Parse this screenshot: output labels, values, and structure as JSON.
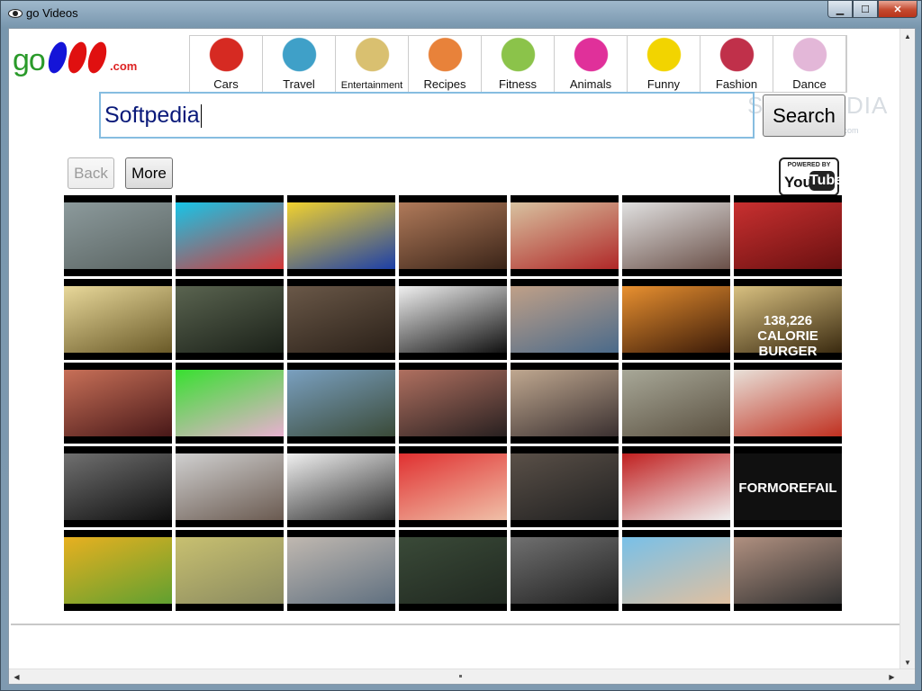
{
  "window": {
    "title": "go Videos"
  },
  "logo": {
    "go": "go",
    "com": ".com"
  },
  "categories": [
    {
      "label": "Cars",
      "icon": "car-icon",
      "color": "#d62a22"
    },
    {
      "label": "Travel",
      "icon": "beach-icon",
      "color": "#3fa0c8"
    },
    {
      "label": "Entertainment",
      "icon": "music-notes-icon",
      "color": "#d9c070"
    },
    {
      "label": "Recipes",
      "icon": "fork-knife-icon",
      "color": "#e8823a"
    },
    {
      "label": "Fitness",
      "icon": "city-icon",
      "color": "#8bc34a"
    },
    {
      "label": "Animals",
      "icon": "animals-icon",
      "color": "#e0309a"
    },
    {
      "label": "Funny",
      "icon": "smiley-icon",
      "color": "#f2d400"
    },
    {
      "label": "Fashion",
      "icon": "models-icon",
      "color": "#c0304a"
    },
    {
      "label": "Dance",
      "icon": "dancer-icon",
      "color": "#e3b7d8"
    }
  ],
  "search": {
    "value": "Softpedia",
    "button_label": "Search"
  },
  "nav": {
    "back_label": "Back",
    "more_label": "More"
  },
  "powered": {
    "line1": "POWERED BY",
    "you": "You",
    "tube": "Tube"
  },
  "watermark": {
    "main": "SOFTPEDIA",
    "sub": "www.softpedia.com"
  },
  "thumbnails": [
    {
      "colors": [
        "#8c9a9c",
        "#5a6462"
      ]
    },
    {
      "colors": [
        "#17c5e8",
        "#d43838"
      ]
    },
    {
      "colors": [
        "#f2d22e",
        "#1c3fa8"
      ]
    },
    {
      "colors": [
        "#b07a5a",
        "#3a2418"
      ]
    },
    {
      "colors": [
        "#d8c2a0",
        "#b02828"
      ]
    },
    {
      "colors": [
        "#e0e0e0",
        "#6a5048"
      ]
    },
    {
      "colors": [
        "#c83030",
        "#6a1010"
      ]
    },
    {
      "colors": [
        "#e8d89a",
        "#6a5a28"
      ]
    },
    {
      "colors": [
        "#5a6450",
        "#1a2018"
      ]
    },
    {
      "colors": [
        "#6a5848",
        "#2a2018"
      ]
    },
    {
      "colors": [
        "#f0f0f0",
        "#101010"
      ]
    },
    {
      "colors": [
        "#c0a088",
        "#4a6a8a"
      ]
    },
    {
      "colors": [
        "#e89030",
        "#3a1a08"
      ]
    },
    {
      "colors": [
        "#d8c080",
        "#3a2a10"
      ],
      "caption": "138,226 CALORIE BURGER"
    },
    {
      "colors": [
        "#c87058",
        "#481818"
      ]
    },
    {
      "colors": [
        "#38e030",
        "#e8b0d0"
      ]
    },
    {
      "colors": [
        "#7aa0c0",
        "#3a4a38"
      ]
    },
    {
      "colors": [
        "#b07060",
        "#282020"
      ]
    },
    {
      "colors": [
        "#c0a890",
        "#3a3030"
      ]
    },
    {
      "colors": [
        "#a8a898",
        "#5a5040"
      ]
    },
    {
      "colors": [
        "#e8e0d8",
        "#c03020"
      ]
    },
    {
      "colors": [
        "#707070",
        "#101010"
      ]
    },
    {
      "colors": [
        "#d0d0d0",
        "#6a5a50"
      ]
    },
    {
      "colors": [
        "#f0f0f0",
        "#2a2a2a"
      ]
    },
    {
      "colors": [
        "#e03030",
        "#f0c0a8"
      ]
    },
    {
      "colors": [
        "#5a5048",
        "#202020"
      ]
    },
    {
      "colors": [
        "#c02020",
        "#f0f0f0"
      ]
    },
    {
      "colors": [
        "#101010",
        "#101010"
      ],
      "caption": "FORMOREFAIL"
    },
    {
      "colors": [
        "#e8b020",
        "#60a030"
      ]
    },
    {
      "colors": [
        "#c8c070",
        "#8a8a60"
      ]
    },
    {
      "colors": [
        "#c0b8b0",
        "#607080"
      ]
    },
    {
      "colors": [
        "#3a4a38",
        "#202820"
      ]
    },
    {
      "colors": [
        "#707070",
        "#202020"
      ]
    },
    {
      "colors": [
        "#78c0e8",
        "#e0c0a0"
      ]
    },
    {
      "colors": [
        "#b09080",
        "#303030"
      ]
    }
  ]
}
